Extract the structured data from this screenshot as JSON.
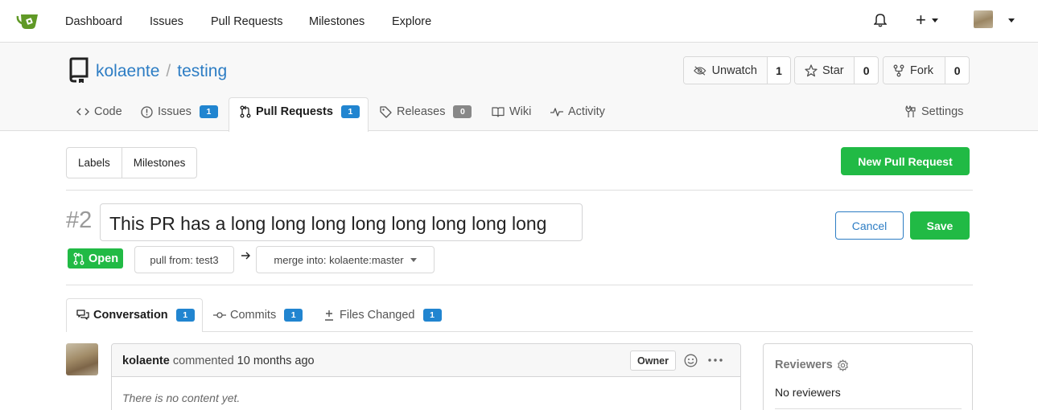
{
  "nav": {
    "items": [
      "Dashboard",
      "Issues",
      "Pull Requests",
      "Milestones",
      "Explore"
    ],
    "plus": "+"
  },
  "repo": {
    "owner": "kolaente",
    "separator": "/",
    "name": "testing",
    "unwatch": {
      "label": "Unwatch",
      "count": "1"
    },
    "star": {
      "label": "Star",
      "count": "0"
    },
    "fork": {
      "label": "Fork",
      "count": "0"
    }
  },
  "tabs": {
    "code": "Code",
    "issues": {
      "label": "Issues",
      "count": "1"
    },
    "pulls": {
      "label": "Pull Requests",
      "count": "1"
    },
    "releases": {
      "label": "Releases",
      "count": "0"
    },
    "wiki": "Wiki",
    "activity": "Activity",
    "settings": "Settings"
  },
  "filters": {
    "labels": "Labels",
    "milestones": "Milestones"
  },
  "new_pr": "New Pull Request",
  "pr": {
    "number": "#2",
    "title_value": "This PR has a long long long long long long long long",
    "cancel": "Cancel",
    "save": "Save",
    "status": "Open",
    "pull_from": "pull from: test3",
    "merge_into": "merge into: kolaente:master"
  },
  "conv_tabs": {
    "conversation": {
      "label": "Conversation",
      "count": "1"
    },
    "commits": {
      "label": "Commits",
      "count": "1"
    },
    "files": {
      "label": "Files Changed",
      "count": "1"
    }
  },
  "comment": {
    "author": "kolaente",
    "action": "commented",
    "time": "10 months ago",
    "role": "Owner",
    "body": "There is no content yet."
  },
  "sidebar": {
    "reviewers_title": "Reviewers",
    "reviewers_value": "No reviewers"
  },
  "colors": {
    "accent": "#2d7dc4",
    "green": "#21ba45",
    "badge": "#2185d0"
  }
}
